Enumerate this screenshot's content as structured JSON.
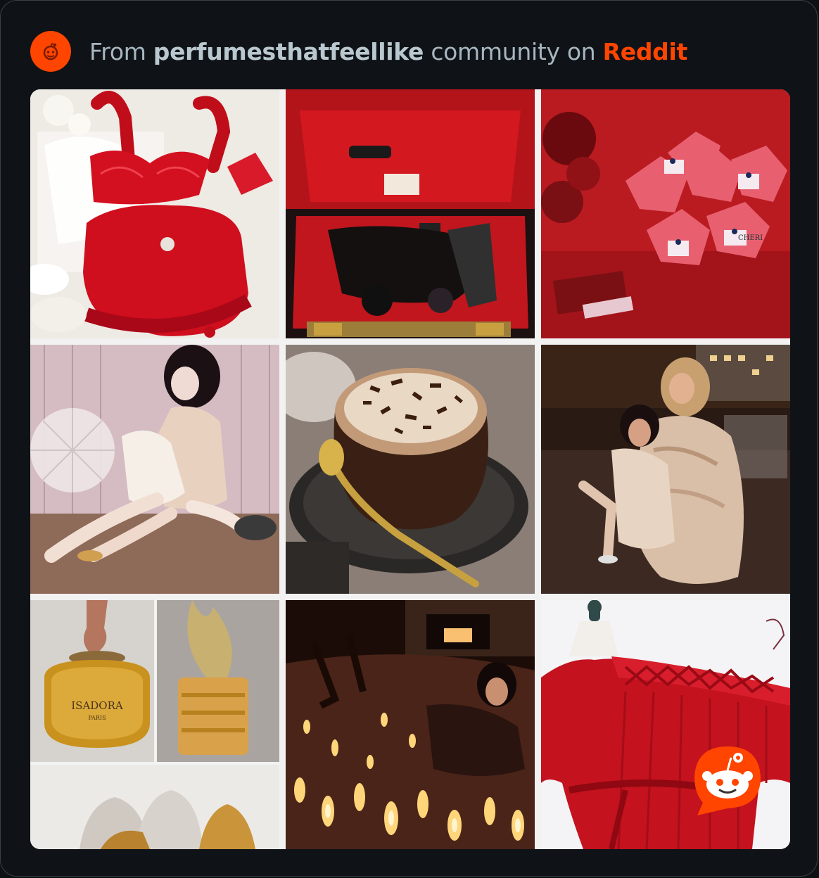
{
  "header": {
    "prefix": "From",
    "community": "perfumesthatfeellike",
    "middle": "community on",
    "platform": "Reddit",
    "avatar_icon": "reddit-community-avatar-icon"
  },
  "grid": {
    "tiles": [
      {
        "subject": "red lingerie set on lace"
      },
      {
        "subject": "open red vanity case with accessories"
      },
      {
        "subject": "wrapped cheri candies in red light"
      },
      {
        "subject": "woman in cream feathers seated on floor"
      },
      {
        "subject": "hot chocolate with chocolate shavings"
      },
      {
        "subject": "two women in fur coats on rooftop"
      },
      {
        "subject": "Isadora perfume bottles"
      },
      {
        "subject": "woman among candles"
      },
      {
        "subject": "red velvet robe on dress form"
      }
    ],
    "bottle_label": "ISADORA",
    "bottle_sub": "PARIS",
    "candy_label": "CHERI"
  },
  "colors": {
    "accent": "#ff4500",
    "background": "#0f1317",
    "text": "#a7b6bf"
  }
}
